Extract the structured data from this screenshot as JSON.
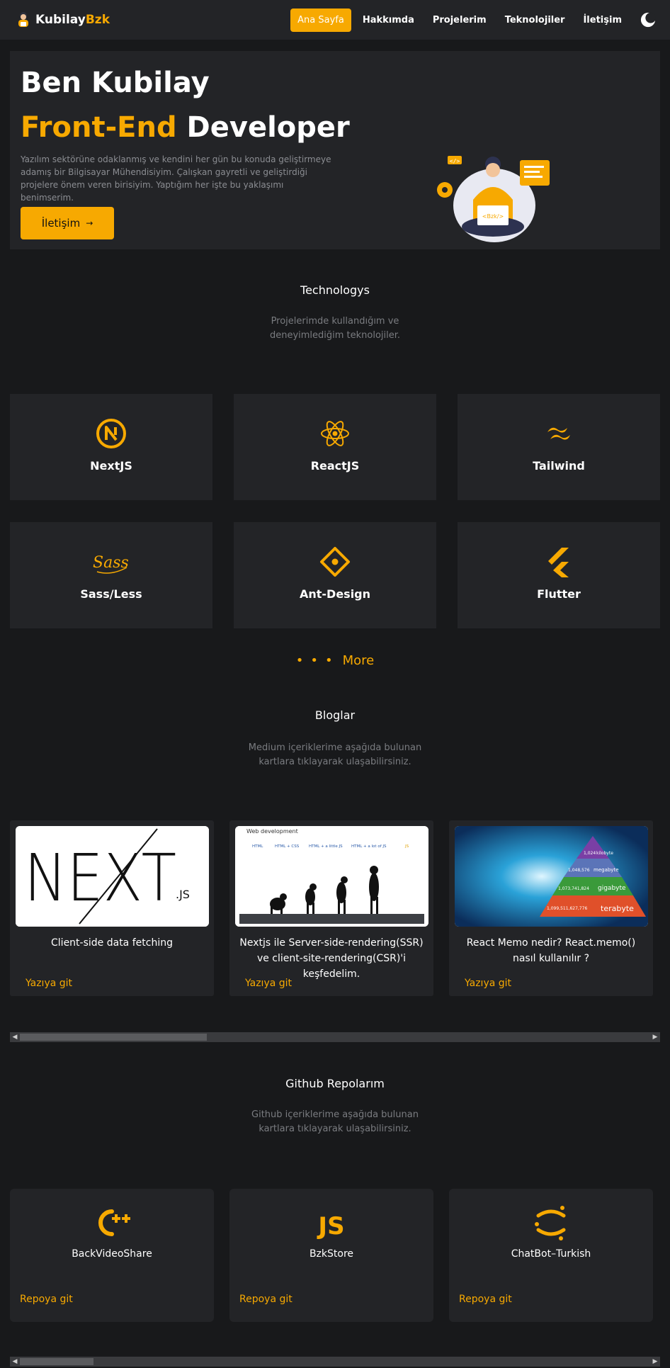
{
  "nav": {
    "brand_first": "Kubilay",
    "brand_second": "Bzk",
    "links": [
      "Ana Sayfa",
      "Hakkımda",
      "Projelerim",
      "Teknolojiler",
      "İletişim"
    ]
  },
  "hero": {
    "greeting": "Ben Kubilay",
    "role_accent": "Front-End",
    "role_rest": " Developer",
    "description": "Yazılım sektörüne odaklanmış ve kendini her gün bu konuda geliştirmeye adamış bir Bilgisayar Mühendisiyim. Çalışkan gayretli ve geliştirdiği projelere önem veren birisiyim. Yaptığım her işte bu yaklaşımı benimserim.",
    "button_label": "İletişim",
    "illustration_text": "<Bzk/>"
  },
  "technologies": {
    "title": "Technologys",
    "description": "Projelerimde kullandığım ve deneyimlediğim teknolojiler.",
    "items": [
      "NextJS",
      "ReactJS",
      "Tailwind",
      "Sass/Less",
      "Ant-Design",
      "Flutter"
    ],
    "more_label": "More"
  },
  "blogs": {
    "title": "Bloglar",
    "description": "Medium içeriklerime aşağıda bulunan kartlara tıklayarak ulaşabilirsiniz.",
    "items": [
      {
        "title": "Client-side data fetching",
        "link": "Yazıya git"
      },
      {
        "title": "Nextjs ile Server-side-rendering(SSR) ve client-site-rendering(CSR)'i keşfedelim.",
        "link": "Yazıya git"
      },
      {
        "title": "React Memo nedir? React.memo() nasıl kullanılır ?",
        "link": "Yazıya git"
      }
    ],
    "img2_caption": "Web development",
    "img2_steps": [
      "HTML",
      "HTML + CSS",
      "HTML + a little JS",
      "HTML + a lot of JS",
      "JS"
    ],
    "img3_labels": [
      "kilobyte",
      "megabyte",
      "gigabyte",
      "terabyte"
    ],
    "img3_numbers": [
      "1,024",
      "1,048,576",
      "1,073,741,824",
      "1,099,511,627,776"
    ],
    "img1_logo": "NEXT",
    "img1_suffix": ".JS"
  },
  "repos": {
    "title": "Github Repolarım",
    "description": "Github içeriklerime aşağıda bulunan kartlara tıklayarak ulaşabilirsiniz.",
    "items": [
      {
        "name": "BackVideoShare",
        "link": "Repoya git"
      },
      {
        "name": "BzkStore",
        "link": "Repoya git"
      },
      {
        "name": "ChatBot–Turkish",
        "link": "Repoya git"
      }
    ],
    "js_logo": "JS"
  },
  "colors": {
    "accent": "#f7a901",
    "background": "#18191b",
    "card": "#232427",
    "muted_text": "#7a7c80"
  }
}
